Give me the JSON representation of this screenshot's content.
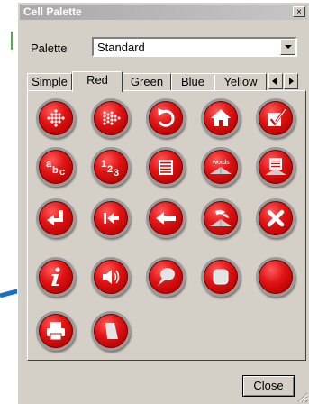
{
  "window": {
    "title": "Cell Palette",
    "close_glyph": "×"
  },
  "palette": {
    "label": "Palette",
    "selected": "Standard"
  },
  "tabs": [
    {
      "label": "Simple",
      "active": false
    },
    {
      "label": "Red",
      "active": true
    },
    {
      "label": "Green",
      "active": false
    },
    {
      "label": "Blue",
      "active": false
    },
    {
      "label": "Yellow",
      "active": false
    }
  ],
  "icons": [
    {
      "name": "diamond-dots-icon"
    },
    {
      "name": "arrow-dots-icon"
    },
    {
      "name": "undo-curve-icon"
    },
    {
      "name": "home-icon"
    },
    {
      "name": "checkmark-icon"
    },
    {
      "name": "abc-icon",
      "text": "abc"
    },
    {
      "name": "123-icon",
      "text": "123"
    },
    {
      "name": "list-icon"
    },
    {
      "name": "words-icon",
      "text": "words"
    },
    {
      "name": "document-icon"
    },
    {
      "name": "enter-return-icon"
    },
    {
      "name": "skip-left-icon"
    },
    {
      "name": "arrow-left-icon"
    },
    {
      "name": "colors-icon"
    },
    {
      "name": "x-close-icon"
    },
    {
      "name": "info-icon"
    },
    {
      "name": "speaker-icon"
    },
    {
      "name": "speech-bubble-icon"
    },
    {
      "name": "square-icon"
    },
    {
      "name": "blank-circle-icon"
    },
    {
      "name": "printer-icon"
    },
    {
      "name": "paper-icon"
    }
  ],
  "colors": {
    "button_red": "#d41010",
    "dialog_gray": "#d4d0c8",
    "pointer_blue": "#1a6fc4"
  },
  "footer": {
    "close_label": "Close"
  }
}
